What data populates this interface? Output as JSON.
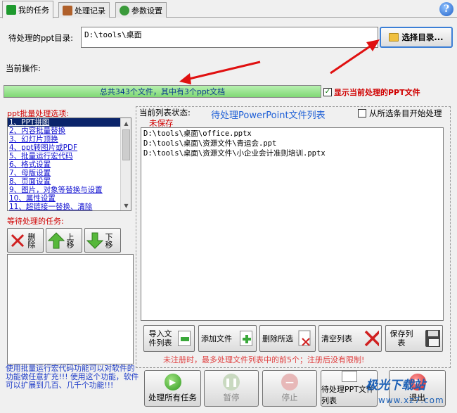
{
  "tabs": [
    {
      "label": "我的任务"
    },
    {
      "label": "处理记录"
    },
    {
      "label": "参数设置"
    }
  ],
  "dir": {
    "label": "待处理的ppt目录:",
    "value": "D:\\tools\\桌面",
    "select_button": "选择目录..."
  },
  "current_op_label": "当前操作:",
  "progress_text": "总共343个文件，其中有3个ppt文档",
  "show_current_label": "显示当前处理的PPT文件",
  "options": {
    "title": "ppt批量处理选项:",
    "items": [
      "1、PPT拼图",
      "2、内容批量替换",
      "3、幻灯片顶换",
      "4、ppt转图片或PDF",
      "5、批量运行宏代码",
      "6、格式设置",
      "7、母版设置",
      "8、页面设置",
      "9、图片，对象等替换与设置",
      "10、属性设置",
      "11、超链接一替换、清除"
    ]
  },
  "tasks": {
    "title": "等待处理的任务:",
    "delete_label": "删除",
    "up_label": "上移",
    "down_label": "下移"
  },
  "filelist": {
    "status_label": "当前列表状态:",
    "status_value": "未保存",
    "title": "待处理PowerPoint文件列表",
    "from_selected": "从所选条目开始处理",
    "files": [
      "D:\\tools\\桌面\\office.pptx",
      "D:\\tools\\桌面\\资源文件\\青运会.ppt",
      "D:\\tools\\桌面\\资源文件\\小企业会计准则培训.pptx"
    ]
  },
  "actions": {
    "import": "导入文件列表",
    "add": "添加文件",
    "delete_selected": "删除所选",
    "clear": "清空列表",
    "save": "保存列表"
  },
  "notice": "未注册时，最多处理文件列表中的前5个；注册后没有限制!",
  "info_text": "使用批量运行宏代码功能可以对软件的功能做任意扩充!!! 使用这个功能，软件可以扩展到几百、几千个功能!!!",
  "bottom": {
    "process_all": "处理所有任务",
    "pause": "暂停",
    "stop": "停止",
    "ppt_list": "待处理PPT文件列表",
    "exit": "退出"
  },
  "watermark": {
    "title": "极光下载站",
    "url": "www.xz7.com"
  },
  "colors": {
    "accent_red": "#d00000",
    "accent_blue": "#1e5fd6",
    "progress_green": "#7fd874"
  }
}
